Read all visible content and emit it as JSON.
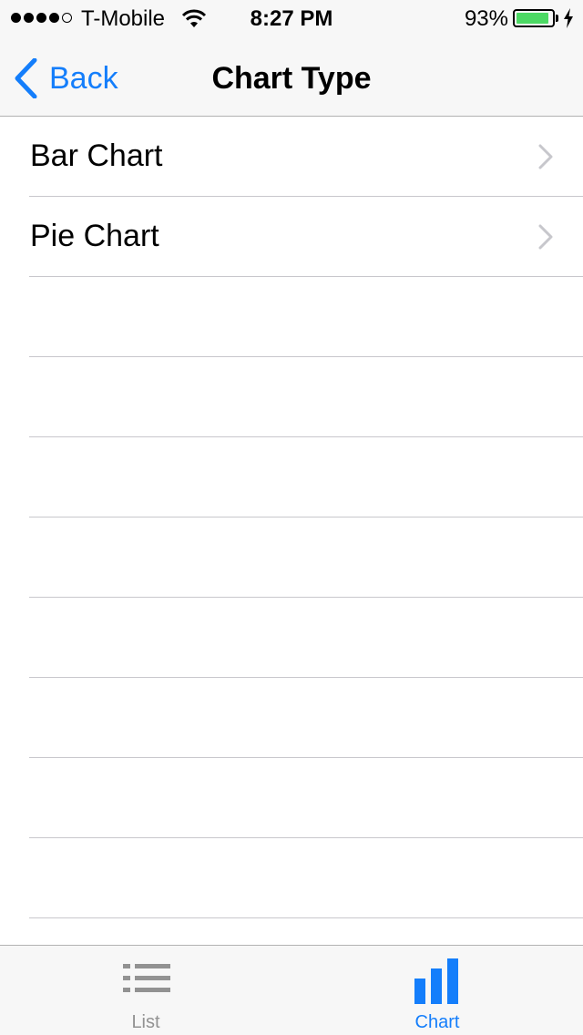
{
  "status_bar": {
    "signal_bars_filled": 4,
    "signal_bars_total": 5,
    "carrier": "T-Mobile",
    "time": "8:27 PM",
    "battery_percent": "93%",
    "battery_level": 0.93,
    "charging": true
  },
  "nav": {
    "back_label": "Back",
    "title": "Chart Type"
  },
  "table": {
    "rows": [
      {
        "label": "Bar Chart",
        "has_disclosure": true
      },
      {
        "label": "Pie Chart",
        "has_disclosure": true
      }
    ],
    "empty_rows": 8
  },
  "tab_bar": {
    "tabs": [
      {
        "label": "List",
        "icon": "list-icon",
        "selected": false
      },
      {
        "label": "Chart",
        "icon": "bar-chart-icon",
        "selected": true
      }
    ]
  },
  "colors": {
    "accent": "#147efb",
    "inactive_tab": "#929292",
    "battery_fill": "#4cd964",
    "separator": "#c8c7cc",
    "chrome_bg": "#f7f7f7"
  }
}
